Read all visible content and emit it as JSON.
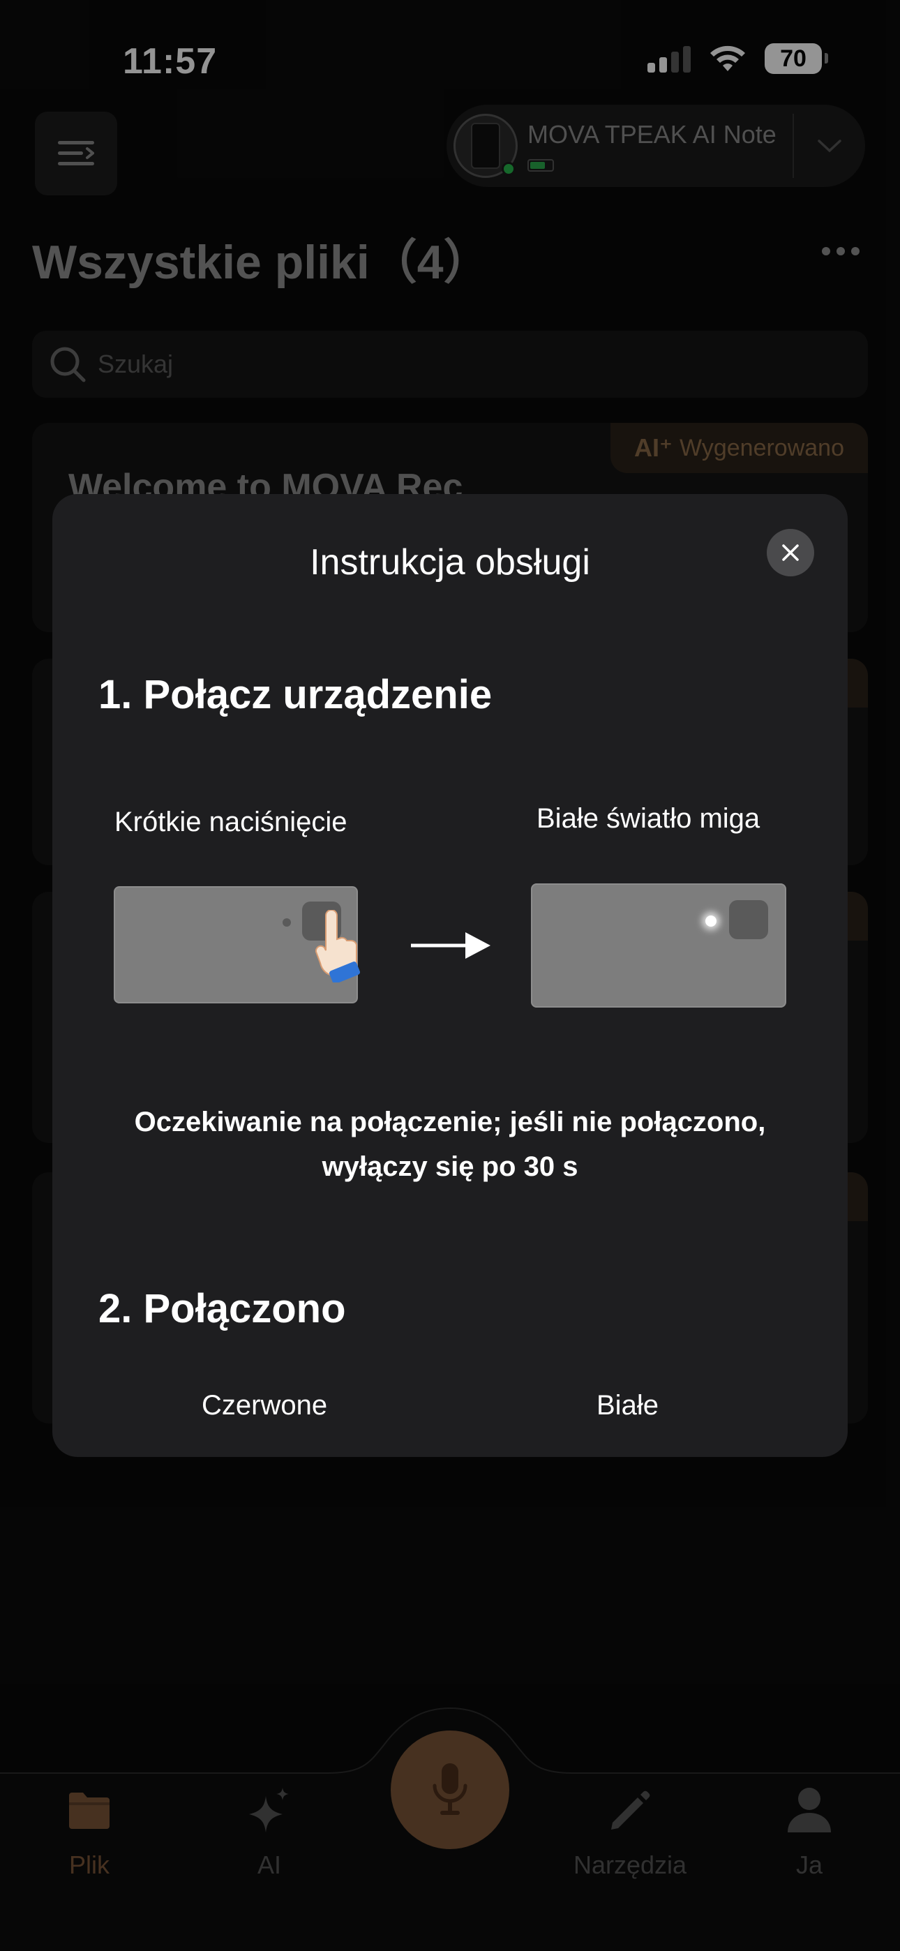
{
  "status_bar": {
    "time": "11:57",
    "battery": "70"
  },
  "header": {
    "device_name": "MOVA TPEAK AI Note",
    "title": "Wszystkie pliki（4）"
  },
  "search": {
    "placeholder": "Szukaj"
  },
  "files": {
    "first_title": "Welcome to MOVA Rec",
    "first_badge": "Wygenerowano",
    "ai_glyph": "AI⁺"
  },
  "modal": {
    "title": "Instrukcja obsługi",
    "step1_title": "1. Połącz urządzenie",
    "step1_left_label": "Krótkie naciśnięcie",
    "step1_right_label": "Białe światło miga",
    "step1_caption": "Oczekiwanie na połączenie; jeśli nie połączono, wyłączy się po 30 s",
    "step2_title": "2. Połączono",
    "step2_left_label": "Czerwone",
    "step2_right_label": "Białe"
  },
  "nav": {
    "items": [
      {
        "label": "Plik",
        "icon": "folder-icon",
        "active": true
      },
      {
        "label": "AI",
        "icon": "sparkle-icon",
        "active": false
      },
      {
        "label": "Narzędzia",
        "icon": "pencil-icon",
        "active": false
      },
      {
        "label": "Ja",
        "icon": "person-icon",
        "active": false
      }
    ],
    "record_icon": "microphone-icon"
  },
  "colors": {
    "accent": "#8a6a48",
    "modal_bg": "#1e1e20",
    "app_bg": "#0a0a0a"
  }
}
